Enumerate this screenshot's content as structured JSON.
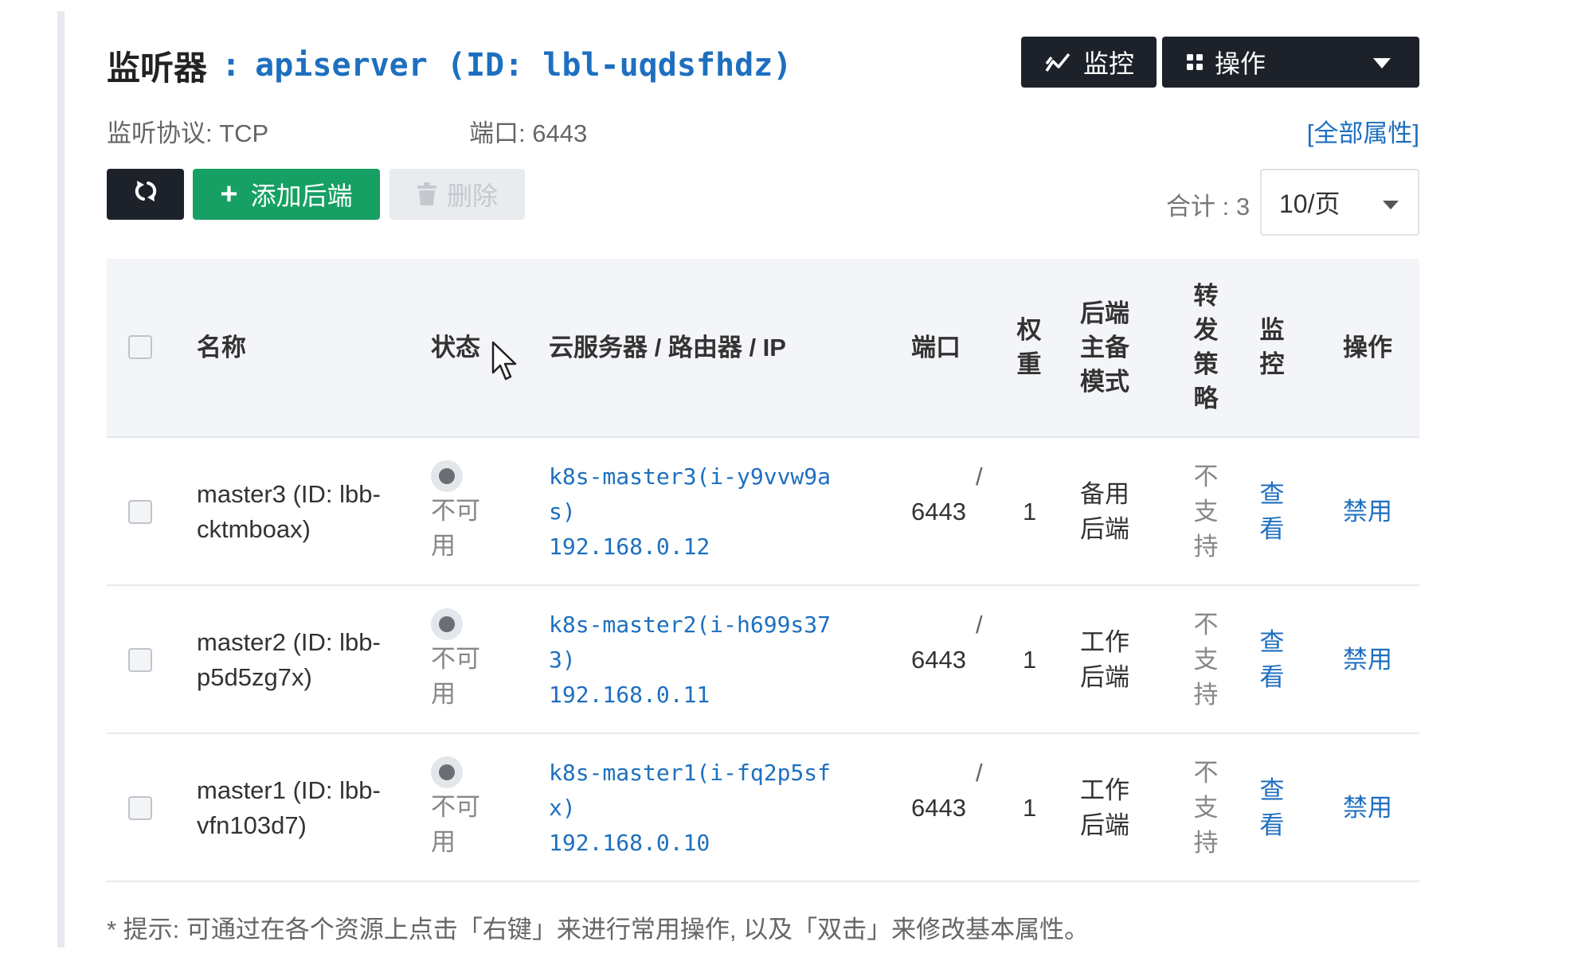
{
  "header": {
    "label": "监听器",
    "separator": ":",
    "name": "apiserver",
    "id_text": "(ID: lbl-uqdsfhdz)",
    "monitor_button": "监控",
    "operations_button": "操作",
    "monitor_icon": "trend-chart-icon",
    "operations_icon": "grid-icon"
  },
  "meta": {
    "protocol": "监听协议: TCP",
    "port": "端口: 6443",
    "all_properties": "[全部属性]"
  },
  "toolbar": {
    "refresh_icon": "refresh-icon",
    "add_label": "添加后端",
    "delete_label": "删除",
    "total": "合计 : 3",
    "page_size": "10/页"
  },
  "table": {
    "columns": {
      "name": "名称",
      "status": "状态",
      "server": "云服务器 / 路由器 / IP",
      "port": "端口",
      "weight": [
        "权",
        "重"
      ],
      "mode": [
        "后端",
        "主备",
        "模式"
      ],
      "policy": [
        "转",
        "发",
        "策",
        "略"
      ],
      "monitor": [
        "监",
        "控"
      ],
      "actions": "操作"
    },
    "rows": [
      {
        "name": [
          "master3 (ID: lbb-",
          "cktmboax)"
        ],
        "status": [
          "不可",
          "用"
        ],
        "server": [
          "k8s-master3(i-y9vvw9a",
          "s)"
        ],
        "slash": "/",
        "ip": "192.168.0.12",
        "port": "6443",
        "weight": "1",
        "mode": [
          "备用",
          "后端"
        ],
        "policy": [
          "不",
          "支",
          "持"
        ],
        "monitor": [
          "查",
          "看"
        ],
        "action": "禁用"
      },
      {
        "name": [
          "master2 (ID: lbb-",
          "p5d5zg7x)"
        ],
        "status": [
          "不可",
          "用"
        ],
        "server": [
          "k8s-master2(i-h699s37",
          "3)"
        ],
        "slash": "/",
        "ip": "192.168.0.11",
        "port": "6443",
        "weight": "1",
        "mode": [
          "工作",
          "后端"
        ],
        "policy": [
          "不",
          "支",
          "持"
        ],
        "monitor": [
          "查",
          "看"
        ],
        "action": "禁用"
      },
      {
        "name": [
          "master1 (ID: lbb-",
          "vfn103d7)"
        ],
        "status": [
          "不可",
          "用"
        ],
        "server": [
          "k8s-master1(i-fq2p5sf",
          "x)"
        ],
        "slash": "/",
        "ip": "192.168.0.10",
        "port": "6443",
        "weight": "1",
        "mode": [
          "工作",
          "后端"
        ],
        "policy": [
          "不",
          "支",
          "持"
        ],
        "monitor": [
          "查",
          "看"
        ],
        "action": "禁用"
      }
    ]
  },
  "hint": "* 提示: 可通过在各个资源上点击「右键」来进行常用操作, 以及「双击」来修改基本属性。"
}
